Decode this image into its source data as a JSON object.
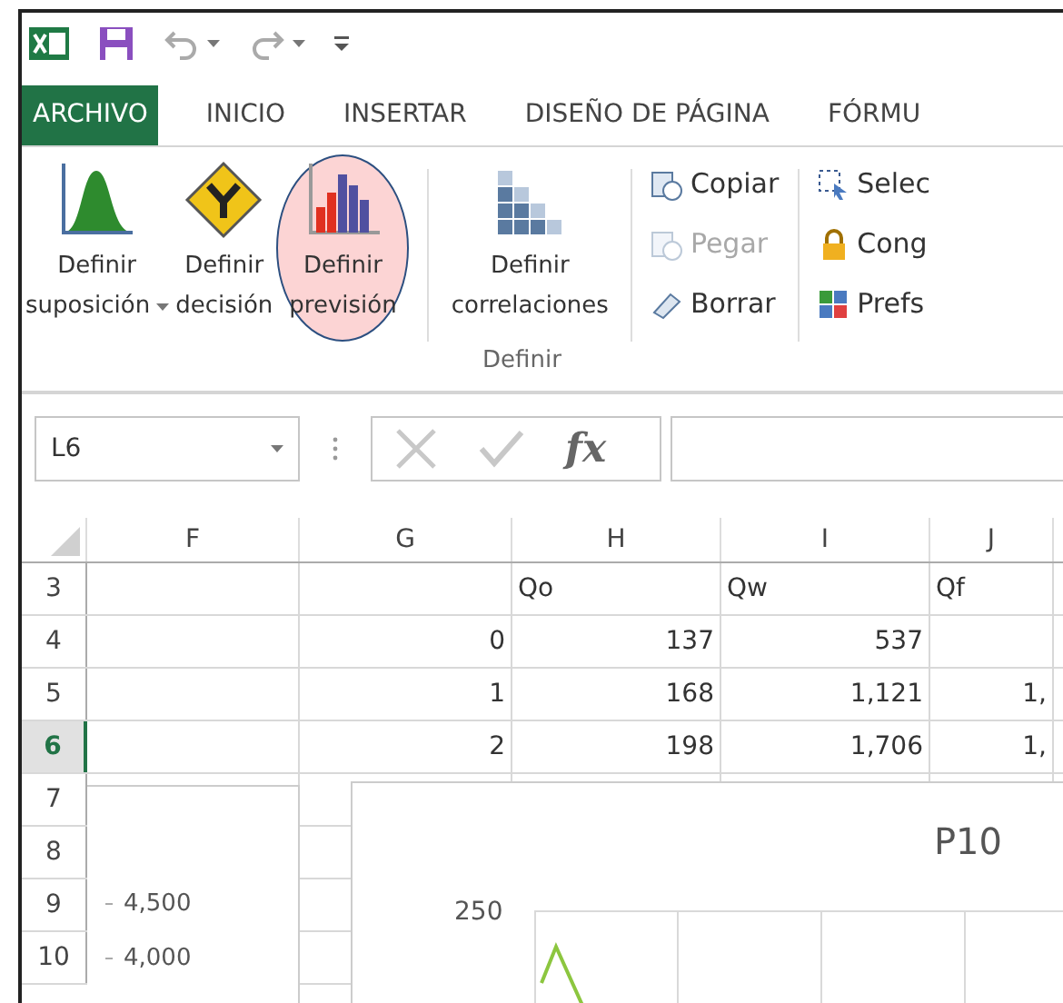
{
  "quick_access": {
    "undo_menu": true,
    "redo_menu": true
  },
  "tabs": [
    {
      "label": "ARCHIVO",
      "selected": true
    },
    {
      "label": "INICIO",
      "selected": false
    },
    {
      "label": "INSERTAR",
      "selected": false
    },
    {
      "label": "DISEÑO DE PÁGINA",
      "selected": false
    },
    {
      "label": "FÓRMU",
      "selected": false
    }
  ],
  "ribbon": {
    "large_buttons": [
      {
        "kind": "assumption",
        "line1": "Definir",
        "line2": "suposición",
        "dropdown": true,
        "highlighted": false
      },
      {
        "kind": "decision",
        "line1": "Definir",
        "line2": "decisión",
        "dropdown": false,
        "highlighted": false
      },
      {
        "kind": "forecast",
        "line1": "Definir",
        "line2": "previsión",
        "dropdown": false,
        "highlighted": true
      },
      {
        "kind": "correlations",
        "line1": "Definir",
        "line2": "correlaciones",
        "dropdown": false,
        "highlighted": false
      }
    ],
    "group_label": "Definir",
    "small_buttons": [
      {
        "kind": "copy",
        "label": "Copiar",
        "disabled": false
      },
      {
        "kind": "paste",
        "label": "Pegar",
        "disabled": true
      },
      {
        "kind": "clear",
        "label": "Borrar",
        "disabled": false
      }
    ],
    "small_buttons_2": [
      {
        "kind": "select",
        "label": "Selec",
        "disabled": false
      },
      {
        "kind": "freeze",
        "label": "Cong",
        "disabled": false
      },
      {
        "kind": "prefs",
        "label": "Prefs",
        "disabled": false
      }
    ]
  },
  "formula_bar": {
    "name_box": "L6",
    "fx": "fx"
  },
  "sheet": {
    "columns": [
      "F",
      "G",
      "H",
      "I",
      "J"
    ],
    "rows": [
      {
        "number": "3",
        "selected": false,
        "kind": "labels",
        "cells": [
          "",
          "",
          "Qo",
          "Qw",
          "Qf"
        ]
      },
      {
        "number": "4",
        "selected": false,
        "kind": "numbers",
        "cells": [
          "",
          "0",
          "137",
          "537",
          ""
        ]
      },
      {
        "number": "5",
        "selected": false,
        "kind": "numbers",
        "cells": [
          "",
          "1",
          "168",
          "1,121",
          "1,"
        ]
      },
      {
        "number": "6",
        "selected": true,
        "kind": "numbers",
        "cells": [
          "",
          "2",
          "198",
          "1,706",
          "1,"
        ]
      },
      {
        "number": "7",
        "selected": false,
        "cells": []
      },
      {
        "number": "8",
        "selected": false,
        "cells": []
      },
      {
        "number": "9",
        "selected": false,
        "cells": []
      },
      {
        "number": "10",
        "selected": false,
        "cells": []
      }
    ]
  },
  "charts": [
    {
      "axis_labels": [
        "4,500",
        "4,000"
      ]
    },
    {
      "title": "P10",
      "axis_labels": [
        "250"
      ]
    }
  ]
}
